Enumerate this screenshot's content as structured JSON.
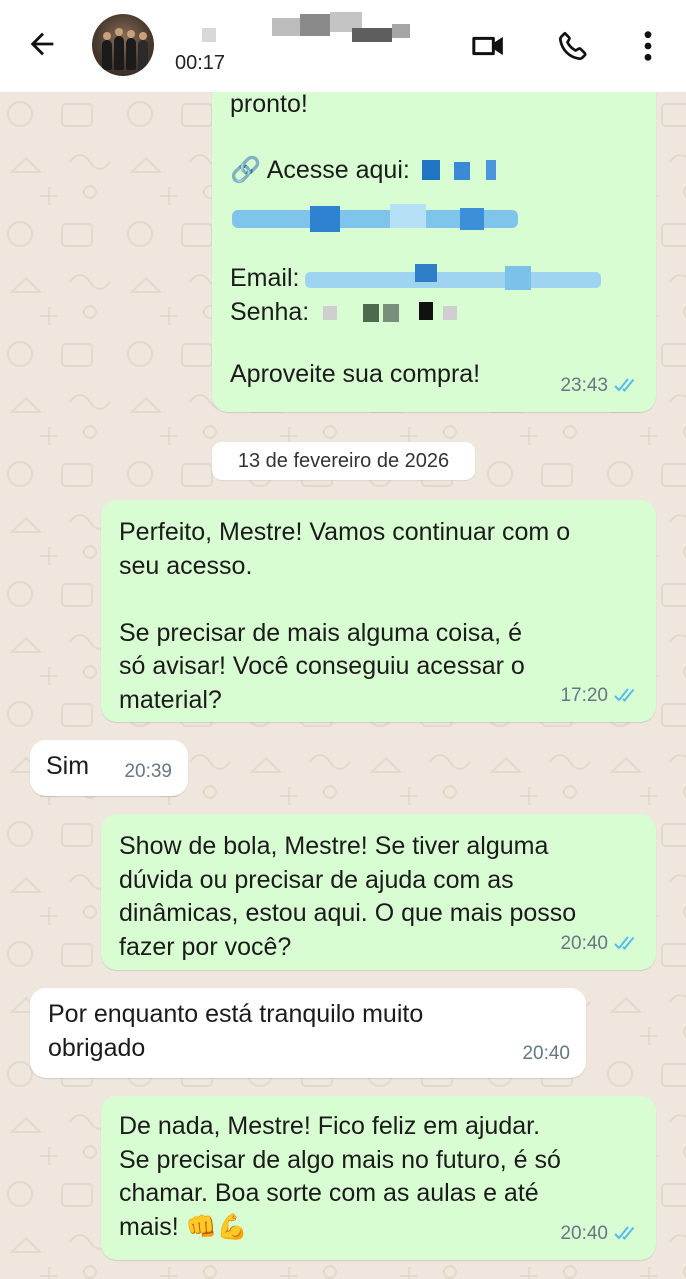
{
  "header": {
    "last_seen": "00:17",
    "back_icon": "arrow-left-icon",
    "video_icon": "video-call-icon",
    "call_icon": "phone-icon",
    "menu_icon": "more-vertical-icon"
  },
  "colors": {
    "outgoing_bubble": "#d9fdd3",
    "incoming_bubble": "#ffffff",
    "read_ticks": "#53bdeb",
    "chat_background": "#efe7de"
  },
  "date_separator": "13 de fevereiro de 2026",
  "messages": [
    {
      "direction": "out",
      "lines_top": "pronto!",
      "link_label": "🔗 Acesse aqui:",
      "email_label": "Email:",
      "password_label": "Senha:",
      "closing": "Aproveite sua compra!",
      "time": "23:43",
      "status": "read"
    },
    {
      "direction": "out",
      "text": "Perfeito, Mestre! Vamos continuar com o\nseu acesso.\n\nSe precisar de mais alguma coisa, é\nsó avisar! Você conseguiu acessar o\nmaterial?",
      "time": "17:20",
      "status": "read"
    },
    {
      "direction": "in",
      "text": "Sim",
      "time": "20:39"
    },
    {
      "direction": "out",
      "text": "Show de bola, Mestre! Se tiver alguma\ndúvida ou precisar de ajuda com as\ndinâmicas, estou aqui. O que mais posso\nfazer por você?",
      "time": "20:40",
      "status": "read"
    },
    {
      "direction": "in",
      "text": "Por enquanto está tranquilo muito\nobrigado",
      "time": "20:40"
    },
    {
      "direction": "out",
      "text": "De nada, Mestre! Fico feliz em ajudar.\nSe precisar de algo mais no futuro, é só\nchamar. Boa sorte com as aulas e até\nmais! 👊💪",
      "time": "20:40",
      "status": "read"
    }
  ]
}
